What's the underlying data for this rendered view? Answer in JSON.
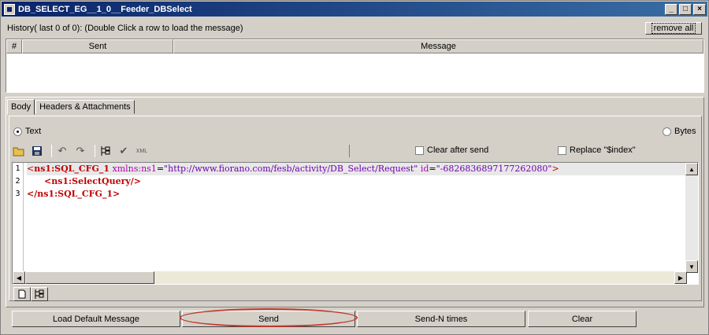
{
  "window": {
    "title": "DB_SELECT_EG__1_0__Feeder_DBSelect"
  },
  "history": {
    "label": "History( last 0 of 0):   (Double Click a row to load the message)",
    "remove_all": "remove all",
    "columns": [
      "#",
      "Sent",
      "Message"
    ]
  },
  "tabs": [
    "Body",
    "Headers & Attachments"
  ],
  "format": {
    "text": "Text",
    "bytes": "Bytes",
    "selected": "Text"
  },
  "options": {
    "clear_after_send": "Clear after send",
    "replace_index": "Replace \"$index\""
  },
  "editor": {
    "line_numbers": [
      "1",
      "2",
      "3"
    ],
    "line1": {
      "open": "<",
      "tag": "ns1:SQL_CFG_1",
      "attr1": "xmlns:ns1",
      "eq1": "=",
      "val1": "\"http://www.fiorano.com/fesb/activity/DB_Select/Request\"",
      "attr2": "id",
      "eq2": "=",
      "val2": "\"-6826836897177262080\"",
      "close": ">"
    },
    "line2": {
      "text": "<ns1:SelectQuery/>"
    },
    "line3": {
      "text": "</ns1:SQL_CFG_1>"
    }
  },
  "actions": {
    "load_default": "Load Default Message",
    "send": "Send",
    "send_n": "Send-N times",
    "clear": "Clear"
  },
  "colors": {
    "title_bar": "#0a246a",
    "tag": "#c00000",
    "attribute": "#b000b0",
    "highlight_oval": "#c0392b"
  }
}
